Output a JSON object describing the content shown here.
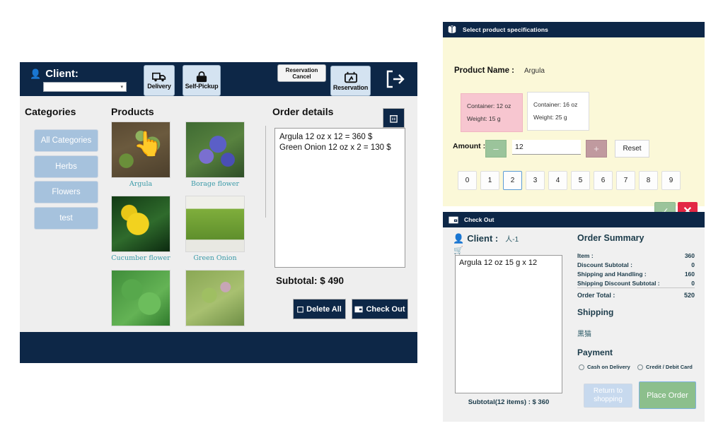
{
  "left_app": {
    "header": {
      "client_label": "Client:",
      "client_select_value": "",
      "buttons": [
        {
          "name": "delivery",
          "label": "Delivery",
          "icon": "truck-icon"
        },
        {
          "name": "self-pickup",
          "label": "Self-Pickup",
          "icon": "bag-icon"
        },
        {
          "name": "reservation",
          "label": "Reservation",
          "icon": "calendar-clock-icon"
        }
      ],
      "reservation_cancel_label": "Reservation\nCancel",
      "logout_icon": "logout-icon"
    },
    "categories": {
      "title": "Categories",
      "items": [
        {
          "label": "All Categories"
        },
        {
          "label": "Herbs"
        },
        {
          "label": "Flowers"
        },
        {
          "label": "test"
        }
      ]
    },
    "products": {
      "title": "Products",
      "items": [
        {
          "label": "Argula",
          "img": "img-argula",
          "cursor": true
        },
        {
          "label": "Borage flower",
          "img": "img-borage",
          "cursor": false
        },
        {
          "label": "Cucumber flower",
          "img": "img-cucumber",
          "cursor": false
        },
        {
          "label": "Green Onion",
          "img": "img-greenonion",
          "cursor": false
        },
        {
          "label": "",
          "img": "img-mint",
          "cursor": false
        },
        {
          "label": "",
          "img": "img-shiso",
          "cursor": false
        }
      ]
    },
    "order_details": {
      "title": "Order details",
      "trash_icon": "trash-icon",
      "lines": "Argula 12 oz x 12 = 360 $\nGreen Onion 12 oz x 2 = 130 $",
      "subtotal": "Subtotal: $ 490",
      "delete_all_label": "Delete All",
      "check_out_label": "Check Out"
    }
  },
  "spec_dialog": {
    "title": "Select product specifications",
    "title_icon": "package-icon",
    "product_name_label": "Product Name :",
    "product_name_value": "Argula",
    "specs": [
      {
        "container": "Container: 12 oz",
        "weight": "Weight: 15 g",
        "selected": true
      },
      {
        "container": "Container: 16 oz",
        "weight": "Weight: 25 g",
        "selected": false
      }
    ],
    "amount_label": "Amount :",
    "minus_label": "–",
    "plus_label": "+",
    "amount_value": "12",
    "reset_label": "Reset",
    "numpad": [
      "0",
      "1",
      "2",
      "3",
      "4",
      "5",
      "6",
      "7",
      "8",
      "9"
    ],
    "numpad_active": "2",
    "confirm_icon": "check-icon",
    "cancel_icon": "close-icon"
  },
  "checkout": {
    "title": "Check Out",
    "title_icon": "wallet-icon",
    "client_label": "Client :",
    "client_value": "人-1",
    "cart_icon": "cart-icon",
    "items": "Argula 12 oz 15 g x 12",
    "subtotal": "Subtotal(12 items) : $ 360",
    "summary_title": "Order Summary",
    "summary_rows": [
      {
        "label": "Item :",
        "value": "360"
      },
      {
        "label": "Discount Subtotal :",
        "value": "0"
      },
      {
        "label": "Shipping and Handling :",
        "value": "160"
      },
      {
        "label": "Shipping Discount Subtotal :",
        "value": "0"
      },
      {
        "label": "Order Total :",
        "value": "520"
      }
    ],
    "shipping_title": "Shipping",
    "shipping_value": "黒猫",
    "payment_title": "Payment",
    "payment_options": [
      {
        "label": "Cash on Delivery"
      },
      {
        "label": "Credit / Debit Card"
      }
    ],
    "return_label": "Return to\nshopping",
    "place_order_label": "Place Order"
  },
  "colors": {
    "navy": "#0d2747",
    "category_blue": "#a6c2dd",
    "spec_bg": "#fbf8d8",
    "selected_pink": "#f7c6d0",
    "green": "#8cbf8c",
    "red": "#e32744",
    "teal_text": "#3a9aa8"
  }
}
